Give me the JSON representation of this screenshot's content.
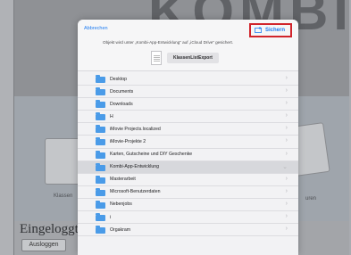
{
  "background_app": {
    "logo_text": "KOMBI",
    "left_card_label": "Klassen",
    "right_card_label": "uren",
    "login_label": "Eingeloggt:",
    "logout_label": "Ausloggen"
  },
  "dialog": {
    "cancel_label": "Abbrechen",
    "save_label": "Sichern",
    "info_text": "Objekt wird unter „Kombi-App-Entwicklung“ auf „iCloud Drive“ gesichert.",
    "file_name": "KlassenListExport",
    "folders": [
      {
        "label": "Desktop",
        "selected": false
      },
      {
        "label": "Documents",
        "selected": false
      },
      {
        "label": "Downloads",
        "selected": false
      },
      {
        "label": "H",
        "selected": false
      },
      {
        "label": "iMovie Projects.localized",
        "selected": false
      },
      {
        "label": "iMovie-Projekte 2",
        "selected": false
      },
      {
        "label": "Karten, Gutscheine und DIY Geschenke",
        "selected": false
      },
      {
        "label": "Kombi-App-Entwicklung",
        "selected": true
      },
      {
        "label": "Masterarbeit",
        "selected": false
      },
      {
        "label": "Microsoft-Benutzerdaten",
        "selected": false
      },
      {
        "label": "Nebenjobs",
        "selected": false
      },
      {
        "label": "i",
        "selected": false
      },
      {
        "label": "Orgakram",
        "selected": false
      }
    ]
  },
  "colors": {
    "accent": "#1e7cf2",
    "highlight_box": "#d1242b",
    "folder": "#4a9be8"
  }
}
